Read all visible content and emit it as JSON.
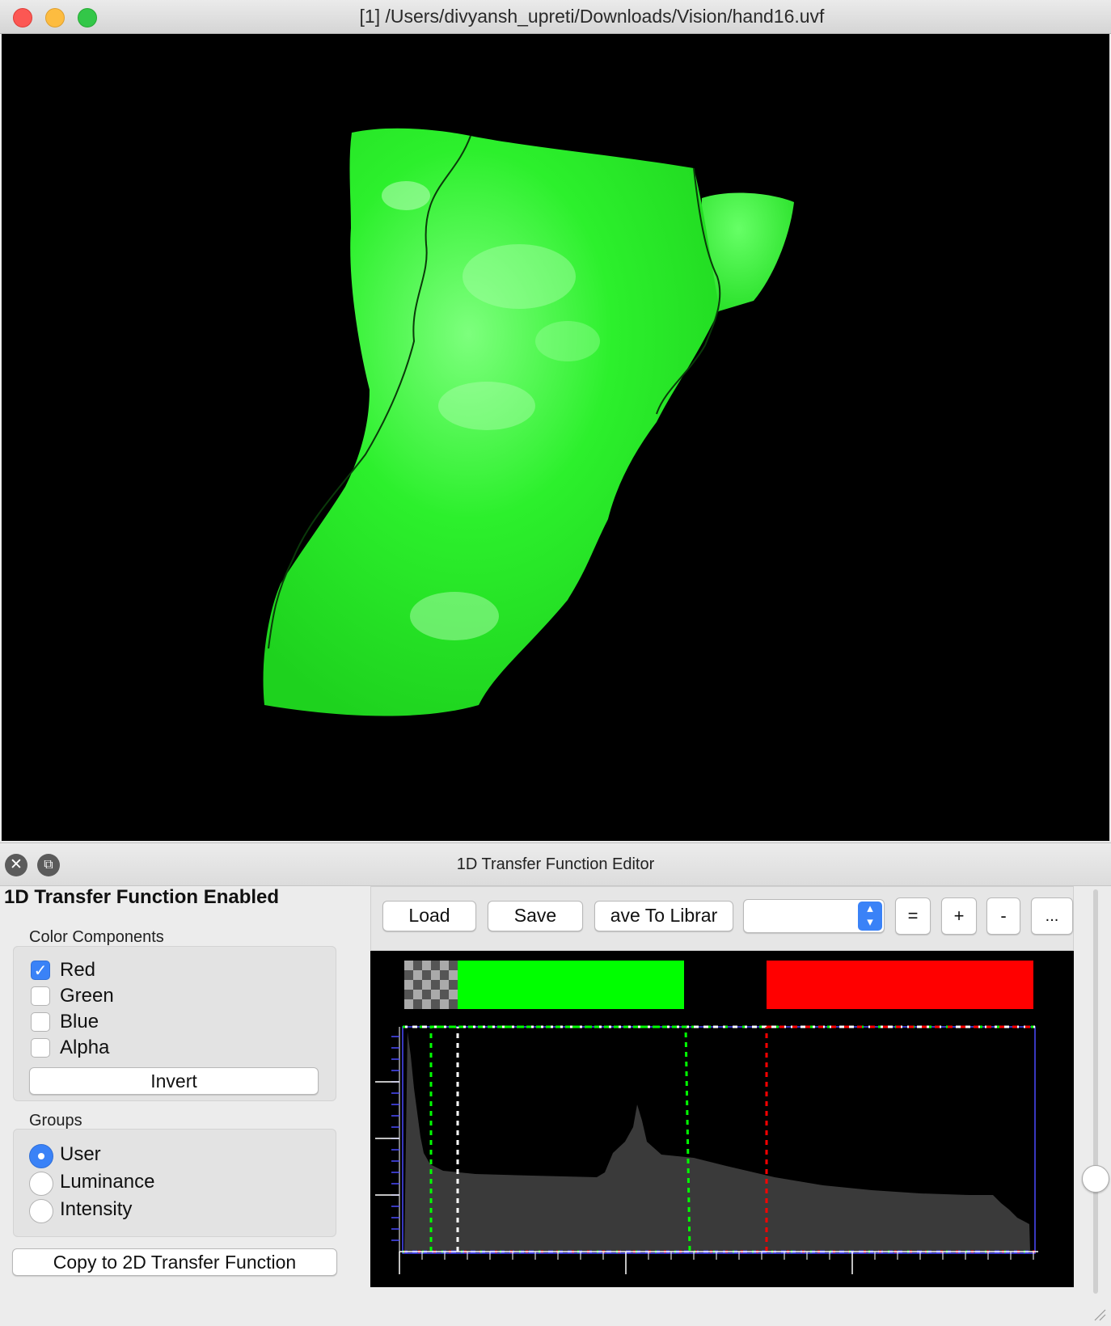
{
  "window": {
    "title": "[1] /Users/divyansh_upreti/Downloads/Vision/hand16.uvf"
  },
  "viewport": {
    "background": "#000000",
    "surface_color": "#22ee22"
  },
  "tf_editor": {
    "panel_title": "1D Transfer Function Editor",
    "enabled_label": "1D Transfer Function Enabled",
    "color_components": {
      "label": "Color Components",
      "items": [
        {
          "label": "Red",
          "checked": true
        },
        {
          "label": "Green",
          "checked": false
        },
        {
          "label": "Blue",
          "checked": false
        },
        {
          "label": "Alpha",
          "checked": false
        }
      ],
      "invert_label": "Invert"
    },
    "groups": {
      "label": "Groups",
      "items": [
        {
          "label": "User",
          "selected": true
        },
        {
          "label": "Luminance",
          "selected": false
        },
        {
          "label": "Intensity",
          "selected": false
        }
      ]
    },
    "copy_label": "Copy to 2D Transfer Function",
    "toolbar": {
      "load_label": "Load",
      "save_label": "Save",
      "save_library_label": "ave To Librar",
      "preset_value": "",
      "equal_label": "=",
      "plus_label": "+",
      "minus_label": "-",
      "more_label": "..."
    },
    "colors": {
      "green": "#00ff00",
      "red": "#ff0000",
      "white": "#ffffff",
      "blue": "#4a4aff",
      "histogram": "#3a3a3a"
    }
  }
}
